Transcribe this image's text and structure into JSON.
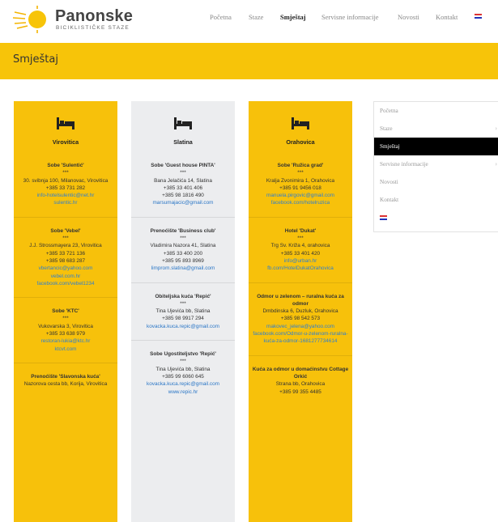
{
  "brand": {
    "title": "Panonske",
    "subtitle": "BICIKLISTIČKE STAZE"
  },
  "nav": {
    "items": [
      "Početna",
      "Staze",
      "Smještaj",
      "Servisne informacije",
      "Novosti",
      "Kontakt"
    ],
    "active": "Smještaj",
    "language_icon": "uk-flag-icon"
  },
  "page": {
    "title": "Smještaj"
  },
  "columns": {
    "a": {
      "city": "Virovitica",
      "entries": [
        {
          "name": "Sobe 'Sulentić'",
          "stars": "***",
          "address": "30. svibnja 100, Milanovac, Virovitica",
          "phones": [
            "+385 33 731 282"
          ],
          "links": [
            "info-hotelsulentic@net.hr",
            "sulentic.hr"
          ]
        },
        {
          "name": "Sobe 'Vebel'",
          "stars": "***",
          "address": "J.J. Strossmayera 23, Virovitica",
          "phones": [
            "+385 33 721 136",
            "+385 98 683 287"
          ],
          "links": [
            "vbertancic@yahoo.com",
            "vebel.com.hr",
            "facebook.com/vebel1234"
          ]
        },
        {
          "name": "Sobe 'KTC'",
          "stars": "***",
          "address": "Vukovarska 3, Virovitica",
          "phones": [
            "+385 33 638 979"
          ],
          "links": [
            "restoran-lukia@ktc.hr",
            "ktcvt.com"
          ]
        },
        {
          "name": "Prenoćište 'Slavonska kuća'",
          "stars": "",
          "address": "Nazorova cesta bb, Korija, Virovitica",
          "phones": [],
          "links": []
        }
      ]
    },
    "b": {
      "city": "Slatina",
      "entries": [
        {
          "name": "Sobe 'Guest house PINTA'",
          "stars": "***",
          "address": "Bana Jelačića 14, Slatina",
          "phones": [
            "+385 33 401 406",
            "+385 98 1816 490"
          ],
          "links": [
            "marsumajacic@gmail.com"
          ]
        },
        {
          "name": "Prenoćište 'Business club'",
          "stars": "***",
          "address": "Vladimira Nazora 41, Slatina",
          "phones": [
            "+385 33 400 200",
            "+385 95 893 8969"
          ],
          "links": [
            "limprom.slatina@gmail.com"
          ]
        },
        {
          "name": "Obiteljska kuća 'Repić'",
          "stars": "***",
          "address": "Tina Ujevića bb, Slatina",
          "phones": [
            "+385 98 9917 294"
          ],
          "links": [
            "kovacka.kuca.repic@gmail.com"
          ]
        },
        {
          "name": "Sobe Ugostiteljstvo 'Repić'",
          "stars": "***",
          "address": "Tina Ujevića bb, Slatina",
          "phones": [
            "+385 99 6060 645"
          ],
          "links": [
            "kovacka.kuca.repic@gmail.com",
            "www.repic.hr"
          ]
        }
      ]
    },
    "c": {
      "city": "Orahovica",
      "entries": [
        {
          "name": "Sobe 'Ružica grad'",
          "stars": "***",
          "address": "Kralja Zvonimira 1, Orahovica",
          "phones": [
            "+385 91 9456 018"
          ],
          "links": [
            "manuela.pirgovic@gmail.com",
            "facebook.com/hotelruzica"
          ]
        },
        {
          "name": "Hotel 'Dukat'",
          "stars": "***",
          "address": "Trg Sv. Križa 4, orahovica",
          "phones": [
            "+385 33 401 420"
          ],
          "links": [
            "info@urban.hr",
            "fb.com/HotelDukatOrahovica"
          ]
        },
        {
          "name": "Odmor u zelenom – ruralna kuća za odmor",
          "stars": "",
          "address": "Dmbdinska 6, Duzluk, Orahovica",
          "phones": [
            "+385 98 542 573"
          ],
          "links": [
            "makovec_jelena@yahoo.com",
            "facebook.com/Odmor-u-zelenom-ruralna-kuća-za-odmor-1681277734614"
          ]
        },
        {
          "name": "Kuća za odmor u domaćinstvu Cottage Orkić",
          "stars": "",
          "address": "Strana bb, Orahovica",
          "phones": [
            "+385 99 355 4485"
          ],
          "links": []
        }
      ]
    }
  },
  "sidebar": {
    "items": [
      {
        "label": "Početna",
        "chevron": false
      },
      {
        "label": "Staze",
        "chevron": true
      },
      {
        "label": "Smještaj",
        "chevron": false
      },
      {
        "label": "Servisne informacije",
        "chevron": true
      },
      {
        "label": "Novosti",
        "chevron": false
      },
      {
        "label": "Kontakt",
        "chevron": false
      }
    ],
    "active": "Smještaj",
    "language_icon": "uk-flag-icon"
  },
  "colors": {
    "accent": "#f7c409",
    "card_grey": "#ecedef",
    "link": "#2a76c6",
    "active_bg": "#000000"
  }
}
